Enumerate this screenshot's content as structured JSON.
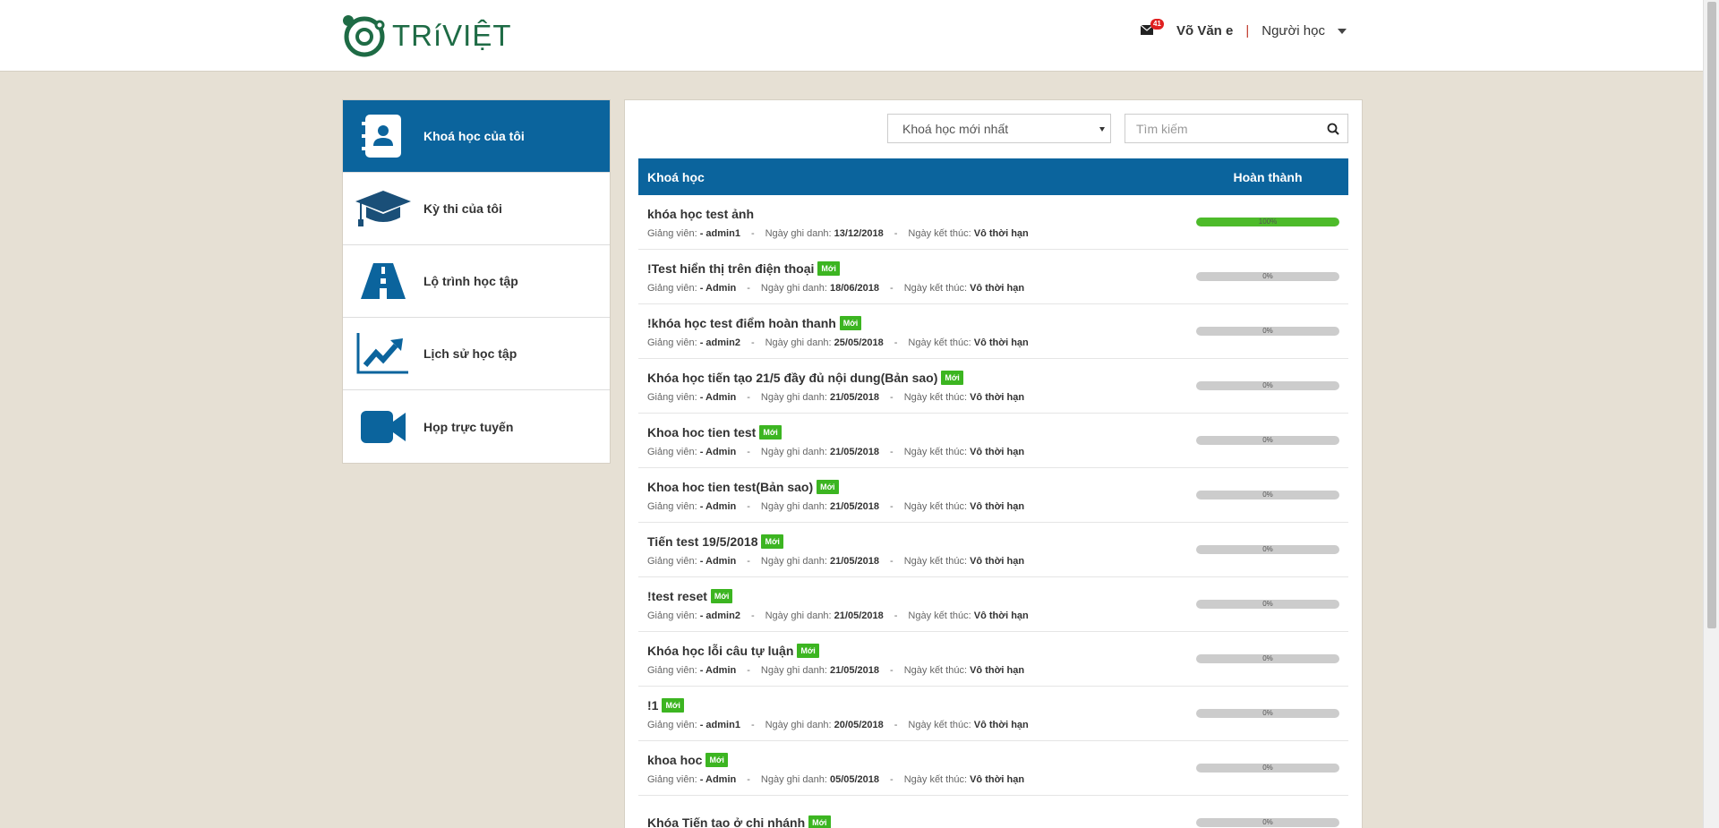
{
  "header": {
    "logo_text": "TRíVIỆT",
    "mail_count": "41",
    "user_name": "Võ Văn e",
    "separator": "|",
    "role": "Người học"
  },
  "sidebar": {
    "items": [
      {
        "label": "Khoá học của tôi",
        "icon": "contact-book-icon",
        "active": true
      },
      {
        "label": "Kỳ thi của tôi",
        "icon": "graduation-cap-icon",
        "active": false
      },
      {
        "label": "Lộ trình học tập",
        "icon": "road-icon",
        "active": false
      },
      {
        "label": "Lịch sử học tập",
        "icon": "trend-chart-icon",
        "active": false
      },
      {
        "label": "Họp trực tuyến",
        "icon": "video-camera-icon",
        "active": false
      }
    ]
  },
  "filter": {
    "sort_value": "Khoá học mới nhất",
    "search_placeholder": "Tìm kiếm"
  },
  "table": {
    "col_course": "Khoá học",
    "col_done": "Hoàn thành",
    "meta_labels": {
      "teacher": "Giảng viên: ",
      "enroll": "Ngày ghi danh: ",
      "end": "Ngày kết thúc: ",
      "dash": "-"
    },
    "badge_label": "Mới",
    "rows": [
      {
        "title": "khóa học test ảnh",
        "is_new": false,
        "teacher": "- admin1",
        "enroll": "13/12/2018",
        "end": "Vô thời hạn",
        "progress": 100,
        "progress_label": "100%"
      },
      {
        "title": "!Test hiển thị trên điện thoại",
        "is_new": true,
        "teacher": "- Admin",
        "enroll": "18/06/2018",
        "end": "Vô thời hạn",
        "progress": 0,
        "progress_label": "0%"
      },
      {
        "title": "!khóa học test điểm hoàn thanh",
        "is_new": true,
        "teacher": "- admin2",
        "enroll": "25/05/2018",
        "end": "Vô thời hạn",
        "progress": 0,
        "progress_label": "0%"
      },
      {
        "title": "Khóa học tiến tạo 21/5 đầy đủ nội dung(Bản sao)",
        "is_new": true,
        "teacher": "- Admin",
        "enroll": "21/05/2018",
        "end": "Vô thời hạn",
        "progress": 0,
        "progress_label": "0%"
      },
      {
        "title": "Khoa hoc tien test",
        "is_new": true,
        "teacher": "- Admin",
        "enroll": "21/05/2018",
        "end": "Vô thời hạn",
        "progress": 0,
        "progress_label": "0%"
      },
      {
        "title": "Khoa hoc tien test(Bản sao)",
        "is_new": true,
        "teacher": "- Admin",
        "enroll": "21/05/2018",
        "end": "Vô thời hạn",
        "progress": 0,
        "progress_label": "0%"
      },
      {
        "title": "Tiến test 19/5/2018",
        "is_new": true,
        "teacher": "- Admin",
        "enroll": "21/05/2018",
        "end": "Vô thời hạn",
        "progress": 0,
        "progress_label": "0%"
      },
      {
        "title": "!test reset",
        "is_new": true,
        "teacher": "- admin2",
        "enroll": "21/05/2018",
        "end": "Vô thời hạn",
        "progress": 0,
        "progress_label": "0%"
      },
      {
        "title": "Khóa học lỗi câu tự luận",
        "is_new": true,
        "teacher": "- Admin",
        "enroll": "21/05/2018",
        "end": "Vô thời hạn",
        "progress": 0,
        "progress_label": "0%"
      },
      {
        "title": "!1",
        "is_new": true,
        "teacher": "- admin1",
        "enroll": "20/05/2018",
        "end": "Vô thời hạn",
        "progress": 0,
        "progress_label": "0%"
      },
      {
        "title": "khoa hoc",
        "is_new": true,
        "teacher": "- Admin",
        "enroll": "05/05/2018",
        "end": "Vô thời hạn",
        "progress": 0,
        "progress_label": "0%"
      },
      {
        "title": "Khóa Tiến tạo ở chi nhánh",
        "is_new": true,
        "teacher": "",
        "enroll": "",
        "end": "",
        "progress": 0,
        "progress_label": "0%"
      }
    ]
  },
  "colors": {
    "primary": "#0b649d",
    "success": "#3cb521",
    "logo_green": "#1e6b45",
    "background": "#e6e0d4"
  }
}
